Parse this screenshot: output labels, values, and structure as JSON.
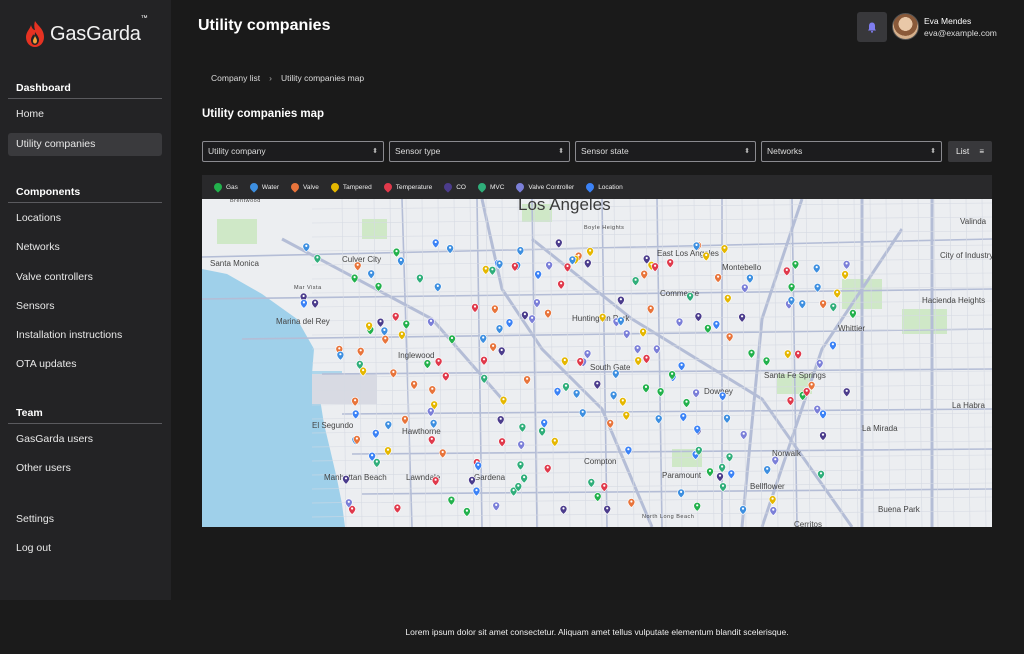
{
  "app": {
    "brand": "GasGarda",
    "tm": "™"
  },
  "sidebar": {
    "dashboard_title": "Dashboard",
    "dashboard_items": [
      "Home",
      "Utility companies"
    ],
    "components_title": "Components",
    "components_items": [
      "Locations",
      "Networks",
      "Valve controllers",
      "Sensors",
      "Installation instructions",
      "OTA updates"
    ],
    "team_title": "Team",
    "team_items": [
      "GasGarda users",
      "Other users"
    ],
    "settings": "Settings",
    "logout": "Log out",
    "active_item": "Utility companies"
  },
  "header": {
    "title": "Utility companies",
    "user_name": "Eva Mendes",
    "user_email": "eva@example.com"
  },
  "breadcrumb": {
    "items": [
      "Company list",
      "Utility companies map"
    ],
    "separator": "›"
  },
  "map_section": {
    "title": "Utility companies map",
    "filters": [
      "Utility company",
      "Sensor type",
      "Sensor state",
      "Networks"
    ],
    "list_button": "List"
  },
  "legend": [
    {
      "label": "Gas",
      "color": "#22b14c"
    },
    {
      "label": "Water",
      "color": "#3d8fe0"
    },
    {
      "label": "Valve",
      "color": "#e8743b"
    },
    {
      "label": "Tampered",
      "color": "#e5b700"
    },
    {
      "label": "Temperature",
      "color": "#e0394b"
    },
    {
      "label": "CO",
      "color": "#4b3c8c"
    },
    {
      "label": "MVC",
      "color": "#2fae7a"
    },
    {
      "label": "Valve Controller",
      "color": "#7b7fd8"
    },
    {
      "label": "Location",
      "color": "#3b82f6"
    }
  ],
  "map_labels": {
    "city_main": "Los Angeles",
    "places": [
      "Santa Monica",
      "Culver City",
      "East Los Angeles",
      "Montebello",
      "City of Industry",
      "Valinda",
      "Hacienda Heights",
      "Whittier",
      "Commerce",
      "Huntington Park",
      "South Gate",
      "Santa Fe Springs",
      "Downey",
      "La Habra",
      "La Mirada",
      "Norwalk",
      "Bellflower",
      "Paramount",
      "Compton",
      "Hawthorne",
      "El Segundo",
      "Lawndale",
      "Manhattan Beach",
      "Inglewood",
      "Marina del Rey",
      "Gardena",
      "Buena Park",
      "Cerritos",
      "North Long Beach",
      "Boyle Heights",
      "Brentwood",
      "Mar Vista"
    ]
  },
  "footer": {
    "text": "Lorem ipsum dolor sit amet consectetur. Aliquam amet tellus vulputate elementum blandit scelerisque."
  }
}
